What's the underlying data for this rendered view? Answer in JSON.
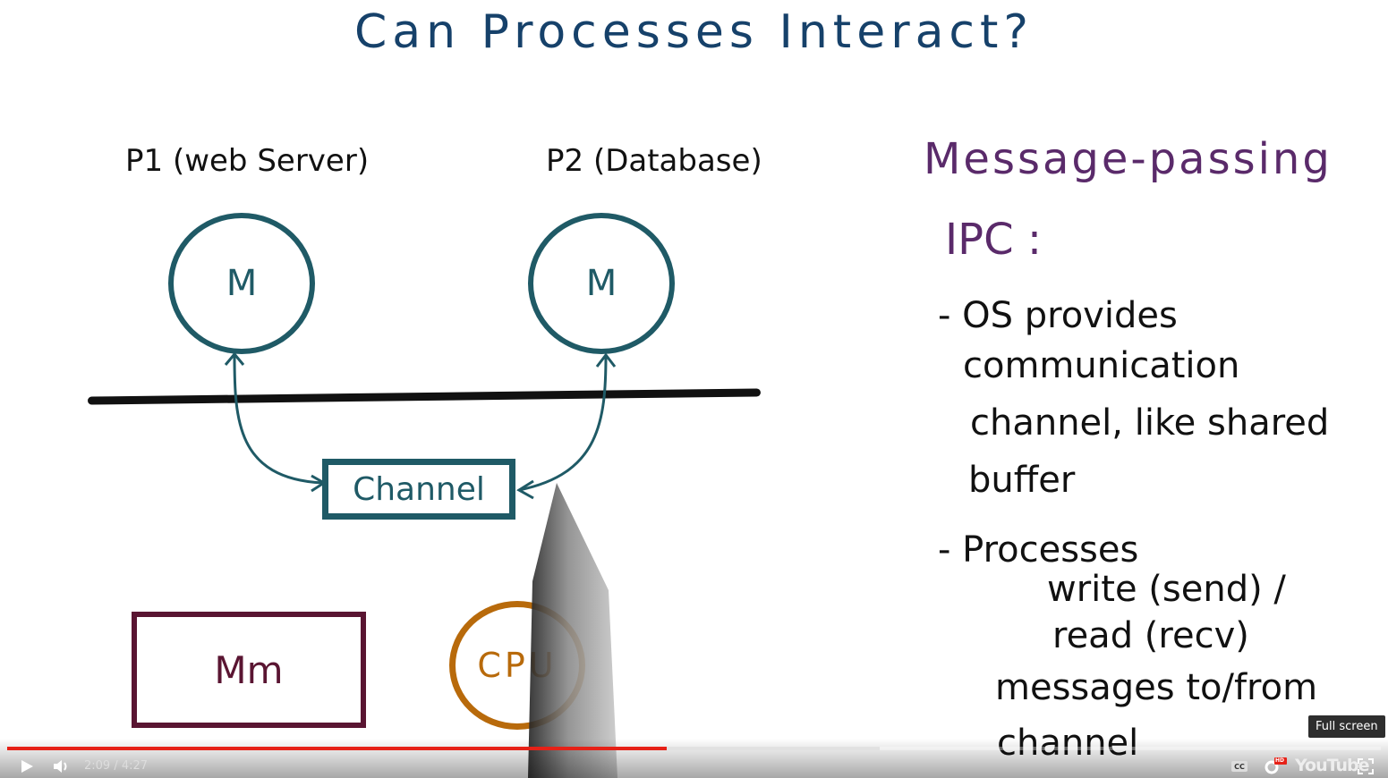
{
  "slide": {
    "title": "Can Processes Interact?",
    "p1_label": "P1 (web Server)",
    "p2_label": "P2 (Database)",
    "p1_circle": "M",
    "p2_circle": "M",
    "channel": "Channel",
    "mm": "Mm",
    "cpu": "CPU",
    "notes": {
      "heading1": "Message-passing",
      "heading2": "IPC :",
      "bullet1_line1": "- OS provides",
      "bullet1_line2": "communication",
      "bullet1_line3": "channel, like shared",
      "bullet1_line4": "buffer",
      "bullet2_line1": "- Processes",
      "bullet2_line2": "write (send) /",
      "bullet2_line3": "read (recv)",
      "bullet2_line4": "messages to/from",
      "bullet2_line5": "channel"
    },
    "colors": {
      "teal": "#1f5a66",
      "title_blue": "#16416a",
      "purple": "#5a2a6a",
      "maroon": "#5a1532",
      "orange": "#b86a0b"
    }
  },
  "player": {
    "time": "2:09 / 4:27",
    "progress": 0.48,
    "buffered": 0.635,
    "tooltip": "Full screen",
    "brand": "YouTube",
    "hd_badge": "HD",
    "icons": [
      "play-icon",
      "volume-icon",
      "captions-icon",
      "settings-icon",
      "fullscreen-icon"
    ]
  }
}
